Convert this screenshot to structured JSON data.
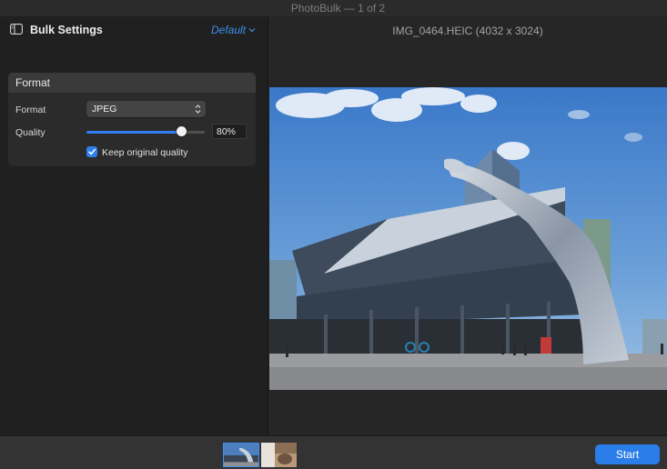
{
  "window": {
    "title": "PhotoBulk — 1 of 2"
  },
  "sidebar": {
    "title": "Bulk Settings",
    "preset": "Default",
    "panel": {
      "title": "Format",
      "format_label": "Format",
      "format_value": "JPEG",
      "quality_label": "Quality",
      "quality_value": "80%",
      "quality_fraction": 0.8,
      "keep_original_label": "Keep original quality",
      "keep_original_checked": true
    }
  },
  "viewer": {
    "filename": "IMG_0464.HEIC (4032 x 3024)"
  },
  "thumbnails": {
    "count": 2,
    "selected": 1
  },
  "footer": {
    "start_label": "Start"
  },
  "colors": {
    "accent": "#2b7de9",
    "link": "#3d8ef0"
  }
}
